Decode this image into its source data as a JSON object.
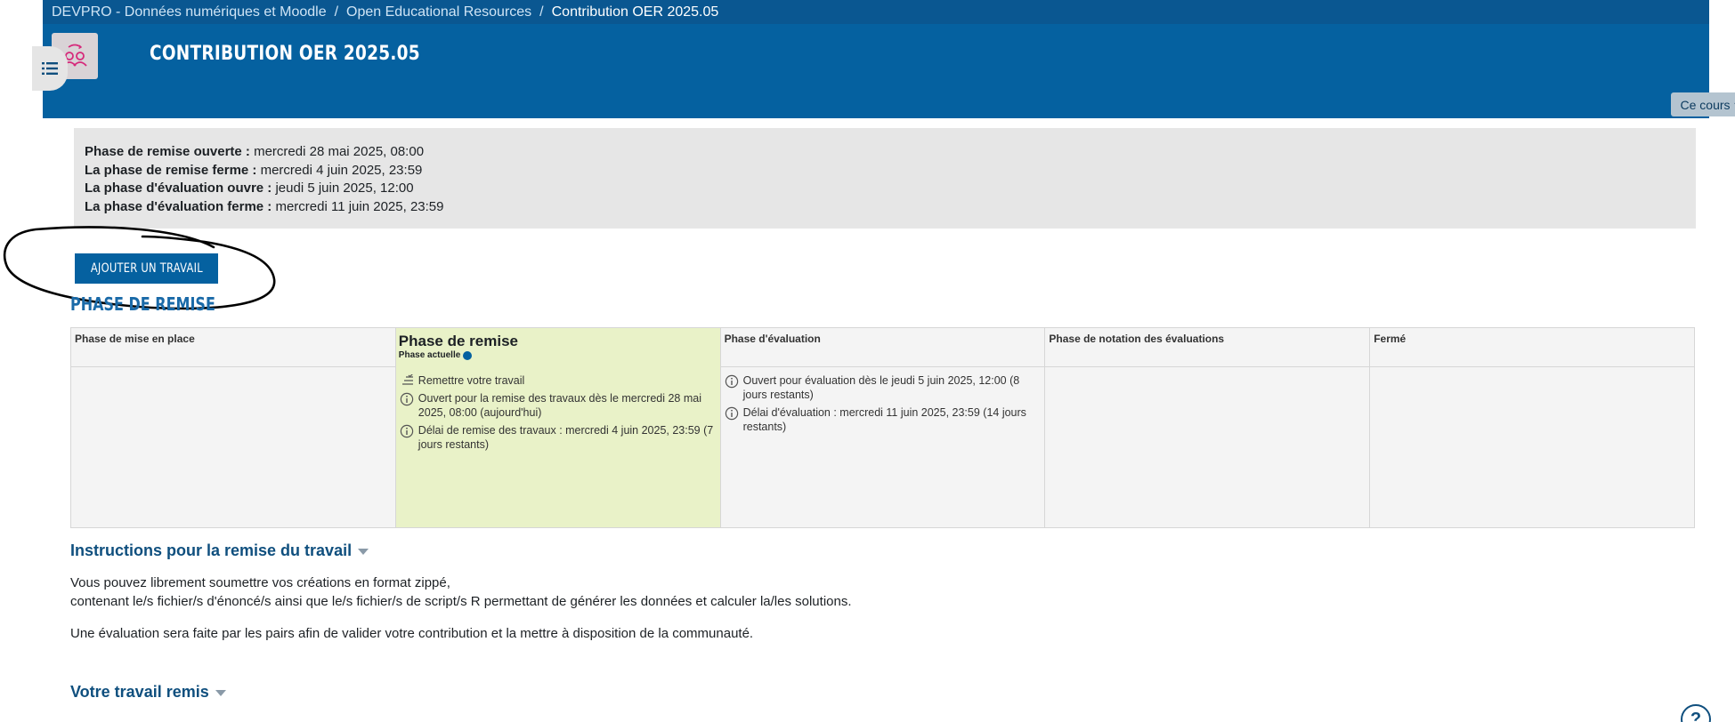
{
  "breadcrumb": [
    {
      "label": "DEVPRO - Données numériques et Moodle"
    },
    {
      "label": "Open Educational Resources"
    },
    {
      "label": "Contribution OER 2025.05"
    }
  ],
  "breadcrumb_separator": "/",
  "header": {
    "title": "CONTRIBUTION OER 2025.05",
    "course_menu_label": "Ce cours",
    "brand_color": "#0561a0"
  },
  "dates": [
    {
      "label": "Phase de remise ouverte :",
      "value": "mercredi 28 mai 2025, 08:00"
    },
    {
      "label": "La phase de remise ferme :",
      "value": "mercredi 4 juin 2025, 23:59"
    },
    {
      "label": "La phase d'évaluation ouvre :",
      "value": "jeudi 5 juin 2025, 12:00"
    },
    {
      "label": "La phase d'évaluation ferme :",
      "value": "mercredi 11 juin 2025, 23:59"
    }
  ],
  "add_submission_label": "AJOUTER UN TRAVAIL",
  "section_heading": "PHASE DE REMISE",
  "phases": [
    {
      "title": "Phase de mise en place",
      "tasks": []
    },
    {
      "title": "Phase de remise",
      "current_label": "Phase actuelle",
      "tasks": [
        {
          "icon": "todo-icon",
          "text": "Remettre votre travail"
        },
        {
          "icon": "info-icon",
          "text": "Ouvert pour la remise des travaux dès le mercredi 28 mai 2025, 08:00 (aujourd'hui)"
        },
        {
          "icon": "info-icon",
          "text": "Délai de remise des travaux : mercredi 4 juin 2025, 23:59 (7 jours restants)"
        }
      ]
    },
    {
      "title": "Phase d'évaluation",
      "tasks": [
        {
          "icon": "info-icon",
          "text": "Ouvert pour évaluation dès le jeudi 5 juin 2025, 12:00 (8 jours restants)"
        },
        {
          "icon": "info-icon",
          "text": "Délai d'évaluation : mercredi 11 juin 2025, 23:59 (14 jours restants)"
        }
      ]
    },
    {
      "title": "Phase de notation des évaluations",
      "tasks": []
    },
    {
      "title": "Fermé",
      "tasks": []
    }
  ],
  "instructions": {
    "heading": "Instructions pour la remise du travail",
    "line1": "Vous pouvez librement soumettre vos créations en format zippé,",
    "line2": "contenant le/s fichier/s d'énoncé/s ainsi que le/s fichier/s de script/s R permettant de générer les données et calculer la/les solutions.",
    "line3": "Une évaluation sera faite par les pairs afin de valider votre contribution et la mettre à disposition de la communauté."
  },
  "your_submission_heading": "Votre travail remis",
  "help_label": "?",
  "colors": {
    "active_phase": "#e9f2c8",
    "header": "#0561a0",
    "heading": "#0f4f7e"
  }
}
